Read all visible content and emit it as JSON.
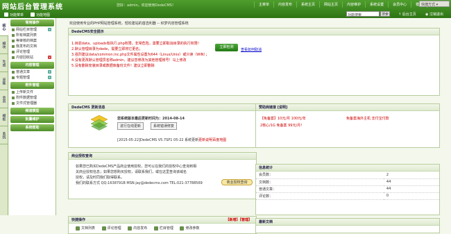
{
  "header": {
    "logo": "网站后台管理系统",
    "sub_links": [
      "功能菜单",
      "功能地图"
    ],
    "welcome": "您好：admin，欢迎使用DedeCMS！",
    "nav": [
      "主菜单",
      "内容发布",
      "系统主页",
      "网站主页",
      "内容维护",
      "系统设置",
      "会员中心",
      "模板",
      "采集"
    ],
    "quick_mode": "快捷方式",
    "search_placeholder": "功能搜索",
    "search_btn": "搜索",
    "home": "后台主页",
    "exit": "注销退出"
  },
  "vtabs": [
    "核心",
    "模块",
    "生成",
    "采集",
    "会员",
    "模板",
    "系统"
  ],
  "sidebar": {
    "sections": [
      {
        "title": "常用操作",
        "items": [
          "网站栏目管理",
          "所有档案列表",
          "等审核的档案",
          "我发布的文档",
          "评论管理",
          "内容回收站"
        ]
      },
      {
        "title": "内容管理",
        "items": [
          "普通文章",
          "专题管理"
        ]
      },
      {
        "title": "附件管理",
        "items": [
          "上传新文件",
          "附件数据管理",
          "文件式管理器"
        ]
      },
      {
        "title": "频道模型",
        "items": []
      },
      {
        "title": "批量维护",
        "items": []
      },
      {
        "title": "系统帮助",
        "items": []
      }
    ]
  },
  "crumb": "欢迎使用专业的PHP网站管理系统，轻松建站的首选利器 -- 织梦内容管理系统",
  "security": {
    "title": "DedeCMS安全提示",
    "lines": [
      "1.目前data、uploads有执行.php权限，非常危险，需要立即取消目录的执行权限！",
      "2.默认管理目录为dede，需要立即将它更名；",
      "3.强烈建议data/common.inc.php文件属性设置为644（Linux/Unix）或只读（WIN）；",
      "4.没有更改默认管理员名称admin，建议您修改为其他管理账号！马上修改",
      "5.没有删除安装目录或数据库备份文件！建议立即删除"
    ],
    "check_btn": "立即检测",
    "close": "查看如何取消"
  },
  "update": {
    "title": "DedeCMS 更新消息",
    "news": "您系统版本最后更新时间为：2014-08-14",
    "btn1": "进行在线更新",
    "btn2": "系统错误修复",
    "detail": "[2015-05-22]DedeCMS V5.7SP1 05-22 系统更新",
    "detail_link": "更新说明",
    "detail_link2": "百度地图"
  },
  "tuiguang": {
    "title": "赞助商链接 [说明]",
    "line1": "【免备案】10元/月 100元/年",
    "line1b": "免备案海外主机 支付宝付款",
    "line2": "2核心/1G 免备案 99元/月！"
  },
  "auth": {
    "title": "商业授权查询",
    "text": [
      "如果您已购买DedeCMS产品商业使用授权，您可以在我们的授权中心查询到相",
      "关商业授权信息；如果您想购买授权，请联系我们，或在这里查询该域名",
      "授权，请及时同我们取得联系。",
      "我们的联系方式 QQ:1638791B MSN:jay@dedecms.com TEL:021-37788569"
    ],
    "btn": "商业授权查询"
  },
  "stats": {
    "title": "信息统计",
    "rows": [
      {
        "k": "会员数：",
        "v": "2"
      },
      {
        "k": "文档数：",
        "v": "44"
      },
      {
        "k": "普通文章：",
        "v": "44"
      },
      {
        "k": "评论数：",
        "v": "0"
      }
    ]
  },
  "quick": {
    "title": "快捷操作",
    "add": "【新增】",
    "manage": "【管理】",
    "items": [
      "文档列表",
      "评论管理",
      "内容发布",
      "栏目管理",
      "修改参数"
    ]
  },
  "latest": {
    "title": "最新文档"
  }
}
